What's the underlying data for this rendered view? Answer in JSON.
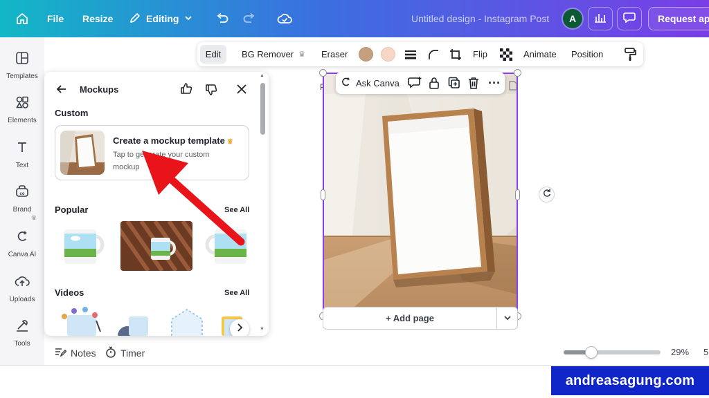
{
  "topbar": {
    "file": "File",
    "resize": "Resize",
    "editing": "Editing",
    "doc_title": "Untitled design - Instagram Post",
    "avatar_initial": "A",
    "request_app": "Request app"
  },
  "rail": {
    "items": [
      {
        "label": "Templates",
        "icon": "templates-icon"
      },
      {
        "label": "Elements",
        "icon": "elements-icon"
      },
      {
        "label": "Text",
        "icon": "text-icon"
      },
      {
        "label": "Brand",
        "icon": "brand-icon"
      },
      {
        "label": "Canva AI",
        "icon": "canva-ai-icon"
      },
      {
        "label": "Uploads",
        "icon": "uploads-icon"
      },
      {
        "label": "Tools",
        "icon": "tools-icon"
      }
    ]
  },
  "panel": {
    "title": "Mockups",
    "custom": "Custom",
    "card_title": "Create a mockup template",
    "card_sub": "Tap to generate your custom mockup",
    "popular": "Popular",
    "videos": "Videos",
    "see_all": "See All"
  },
  "context_toolbar": {
    "edit": "Edit",
    "bg_remover": "BG Remover",
    "eraser": "Eraser",
    "flip": "Flip",
    "animate": "Animate",
    "position": "Position",
    "swatches": [
      "#c4a07e",
      "#f7d6c6"
    ]
  },
  "canvas": {
    "page_label": "Page",
    "ask_canva": "Ask Canva",
    "add_page": "+ Add page"
  },
  "bottom": {
    "notes": "Notes",
    "timer": "Timer",
    "zoom": "29%",
    "zoom_cut": "5"
  },
  "watermark": "andreasagung.com",
  "colors": {
    "accent": "#8b3dff",
    "arrow": "#e8141a"
  }
}
